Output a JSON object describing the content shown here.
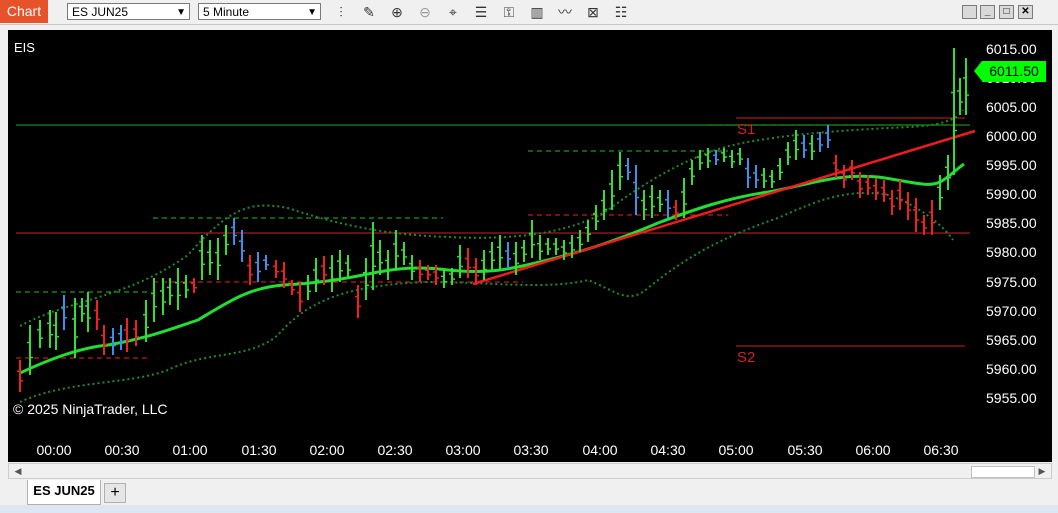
{
  "toolbar": {
    "chart_button": "Chart",
    "instrument_value": "ES JUN25",
    "interval_value": "5 Minute",
    "icons": [
      "bar-type-icon",
      "pencil-draw-icon",
      "zoom-in-icon",
      "zoom-out-icon",
      "crosshair-icon",
      "properties-icon",
      "indicators-icon",
      "strategies-icon",
      "trend-icon",
      "templates-icon",
      "chart-trader-icon"
    ]
  },
  "window_buttons": {
    "restore": "",
    "minimize": "_",
    "maximize": "□",
    "close": "✕"
  },
  "chart": {
    "instrument_label": "EIS",
    "copyright": "© 2025 NinjaTrader, LLC",
    "last_price": "6011.50",
    "price_labels": [
      "6015.00",
      "6010.00",
      "6005.00",
      "6000.00",
      "5995.00",
      "5990.00",
      "5985.00",
      "5980.00",
      "5975.00",
      "5970.00",
      "5965.00",
      "5960.00",
      "5955.00"
    ],
    "time_labels": [
      "00:00",
      "00:30",
      "01:00",
      "01:30",
      "02:00",
      "02:30",
      "03:00",
      "03:30",
      "04:00",
      "04:30",
      "05:00",
      "05:30",
      "06:00",
      "06:30"
    ],
    "s1_label": "S1",
    "s2_label": "S2",
    "colors": {
      "up": "#33dd33",
      "down": "#ee2222",
      "blue": "#3d8fe8",
      "ma": "#22dd33",
      "band": "#1d8c2a",
      "trend": "#ee1c1c"
    }
  },
  "tabs": {
    "active": "ES JUN25",
    "add": "+"
  }
}
